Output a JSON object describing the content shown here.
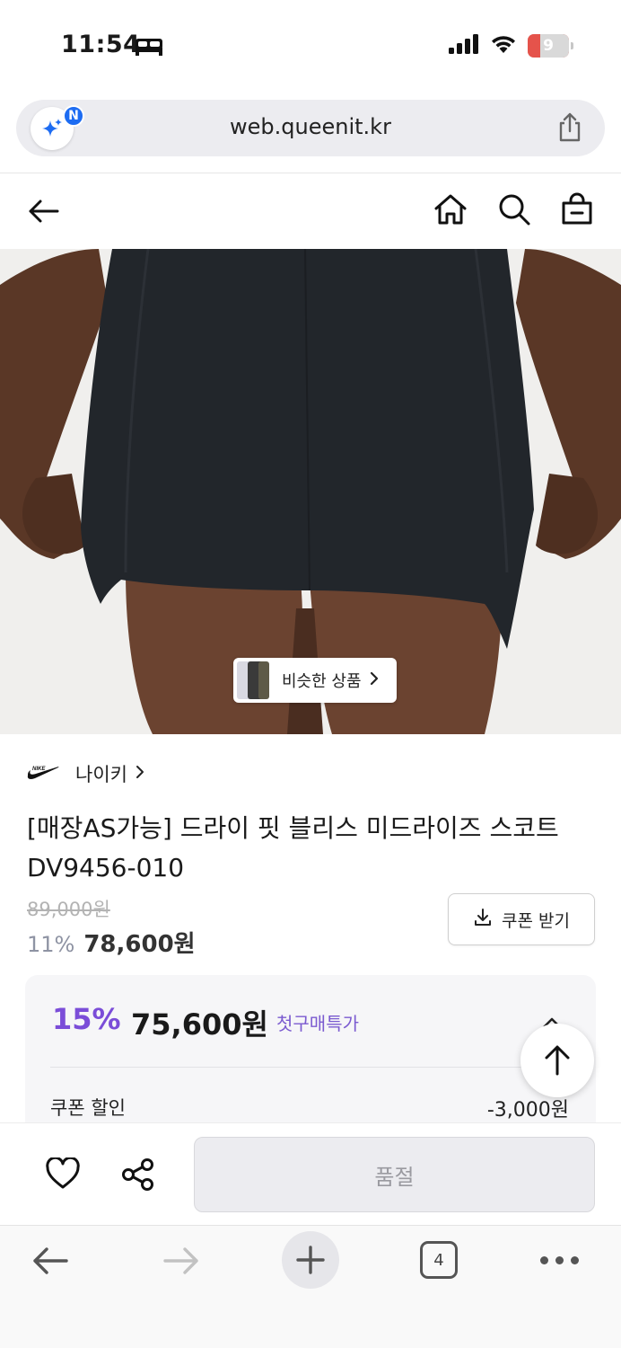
{
  "status_bar": {
    "time": "11:54",
    "battery_level": "9"
  },
  "url_bar": {
    "badge_letter": "N",
    "url": "web.queenit.kr"
  },
  "product": {
    "similar_label": "비슷한 상품",
    "brand": "나이키",
    "title": "[매장AS가능] 드라이 핏 블리스 미드라이즈 스코트 DV9456-010",
    "original_price": "89,000원",
    "discount_rate": "11%",
    "price": "78,600원",
    "coupon_button": "쿠폰 받기"
  },
  "discount_card": {
    "rate": "15%",
    "price": "75,600원",
    "label": "첫구매특가",
    "coupon_label": "쿠폰 할인",
    "coupon_value": "-3,000원"
  },
  "action_bar": {
    "soldout_label": "품절"
  },
  "browser": {
    "tab_count": "4"
  },
  "colors": {
    "accent_purple": "#7b4dd8",
    "ai_blue": "#1d6cf2",
    "battery_red": "#e5534b"
  }
}
